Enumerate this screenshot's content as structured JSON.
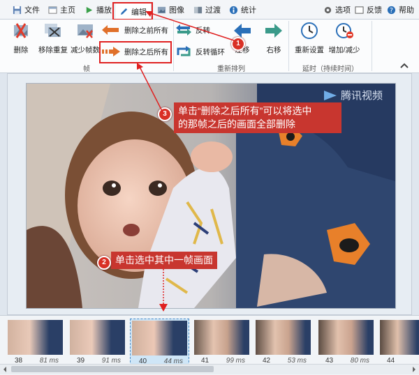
{
  "menu": {
    "tabs": [
      {
        "label": "文件"
      },
      {
        "label": "主页"
      },
      {
        "label": "播放"
      },
      {
        "label": "编辑"
      },
      {
        "label": "图像"
      },
      {
        "label": "过渡"
      },
      {
        "label": "统计"
      }
    ],
    "right": {
      "options": "选项",
      "feedback": "反馈",
      "help": "帮助"
    }
  },
  "ribbon": {
    "frame_group": {
      "label": "帧",
      "delete": "删除",
      "remove_dup": "移除重复",
      "reduce": "减少帧数",
      "delete_before": "删除之前所有",
      "delete_after": "删除之后所有"
    },
    "reorder_group": {
      "label": "重新排列",
      "reverse": "反转",
      "reverse_loop": "反转循环",
      "move_left": "左移",
      "move_right": "右移"
    },
    "delay_group": {
      "label": "延时（持续时间）",
      "reset": "重新设置",
      "adjust": "增加/减少"
    }
  },
  "overlay": {
    "watermark": "腾讯视频",
    "callout3_line1": "单击“删除之后所有”可以将选中",
    "callout3_line2": "的那帧之后的画面全部删除",
    "callout2": "单击选中其中一帧画面",
    "badges": [
      "1",
      "2",
      "3"
    ]
  },
  "frames": [
    {
      "num": "38",
      "ms": "81 ms"
    },
    {
      "num": "39",
      "ms": "91 ms"
    },
    {
      "num": "40",
      "ms": "44 ms"
    },
    {
      "num": "41",
      "ms": "99 ms"
    },
    {
      "num": "42",
      "ms": "53 ms"
    },
    {
      "num": "43",
      "ms": "80 ms"
    },
    {
      "num": "44",
      "ms": ""
    }
  ],
  "colors": {
    "accent": "#d93025",
    "selection": "#4a8cc8"
  }
}
